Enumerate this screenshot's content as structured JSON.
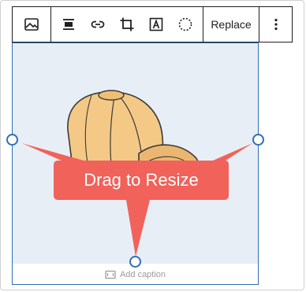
{
  "toolbar": {
    "replace_label": "Replace"
  },
  "image": {
    "caption_placeholder": "Add caption"
  },
  "callout": {
    "label": "Drag to Resize",
    "color": "#f0625a"
  },
  "colors": {
    "selection": "#2f6fb5",
    "toolbar_border": "#1e1e1e",
    "image_bg": "#e8eef5"
  }
}
